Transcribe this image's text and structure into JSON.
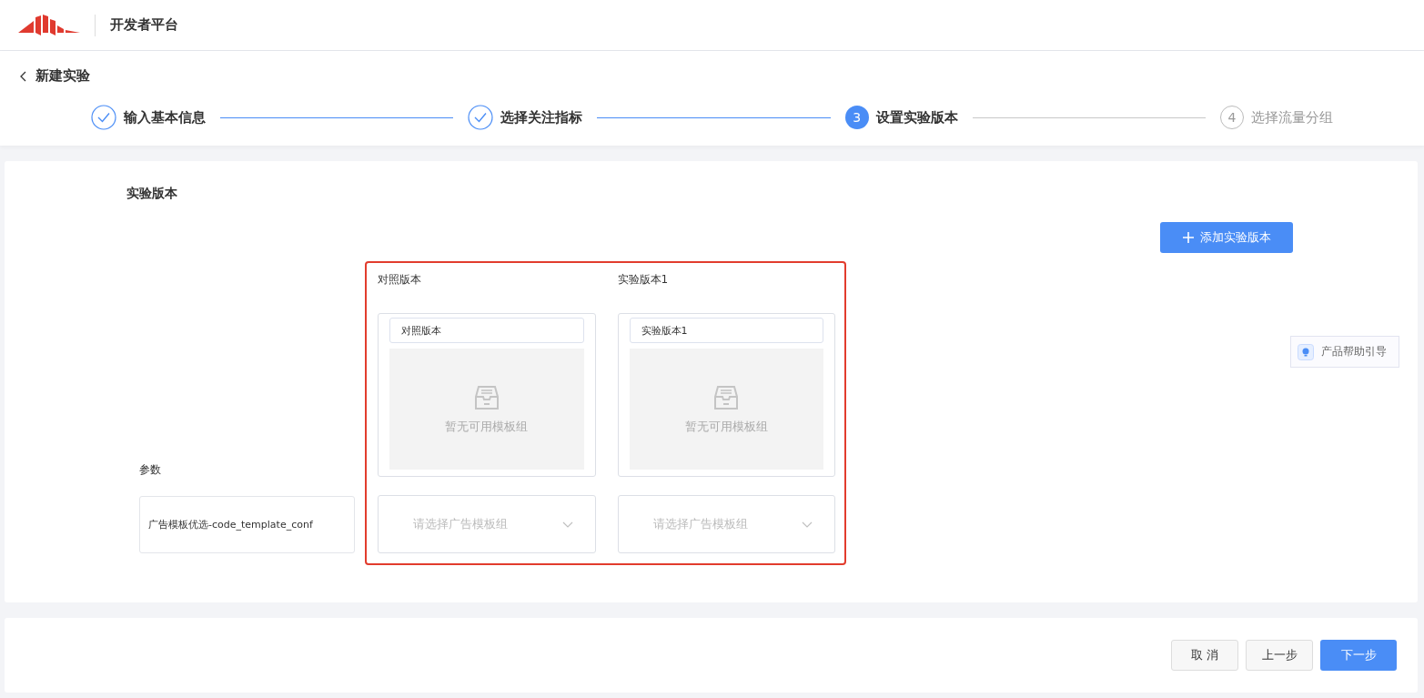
{
  "header": {
    "title": "开发者平台"
  },
  "page": {
    "back_label": "新建实验"
  },
  "steps": [
    {
      "label": "输入基本信息",
      "done": true,
      "selected": false
    },
    {
      "label": "选择关注指标",
      "done": true,
      "selected": false
    },
    {
      "number": "3",
      "label": "设置实验版本",
      "done": false,
      "selected": true
    },
    {
      "number": "4",
      "label": "选择流量分组",
      "done": false,
      "selected": false
    }
  ],
  "section": {
    "title": "实验版本",
    "add_button": "添加实验版本",
    "param_label": "参数",
    "param_value": "广告模板优选-code_template_conf"
  },
  "versions": [
    {
      "label": "对照版本",
      "name": "对照版本",
      "empty_text": "暂无可用模板组",
      "select_placeholder": "请选择广告模板组"
    },
    {
      "label": "实验版本1",
      "name": "实验版本1",
      "empty_text": "暂无可用模板组",
      "select_placeholder": "请选择广告模板组"
    }
  ],
  "help": {
    "label": "产品帮助引导"
  },
  "footer": {
    "buttons": [
      {
        "label": "取 消",
        "kind": "default"
      },
      {
        "label": "上一步",
        "kind": "default"
      },
      {
        "label": "下一步",
        "kind": "primary"
      }
    ]
  }
}
